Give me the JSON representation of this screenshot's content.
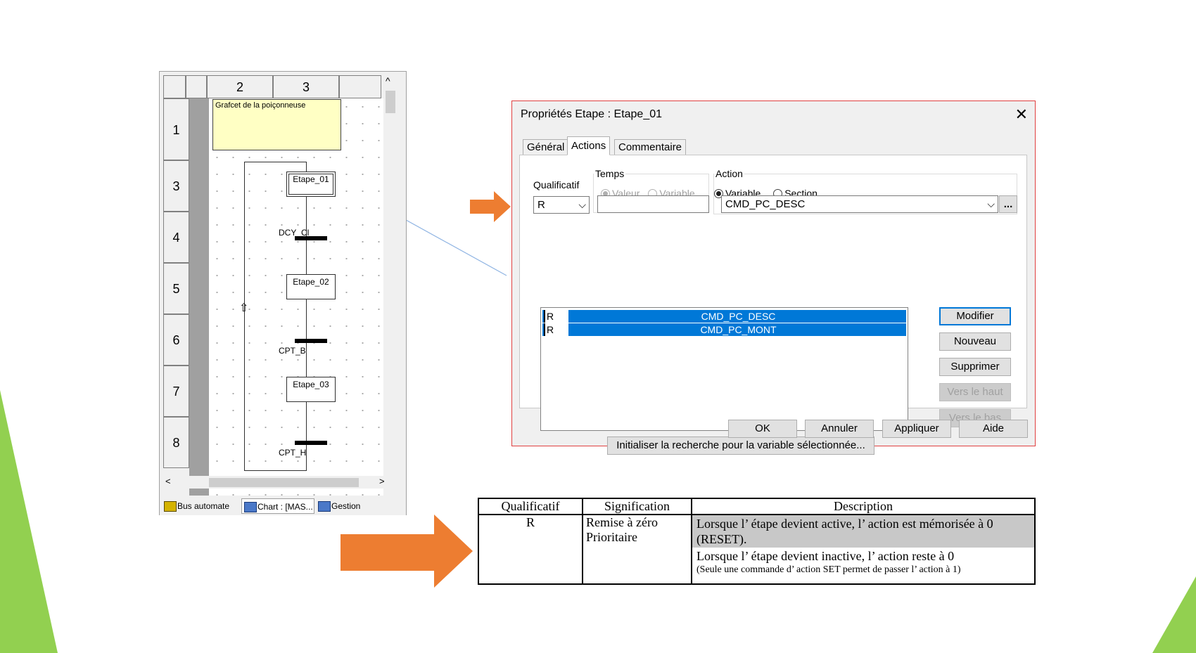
{
  "editor": {
    "col_headers": [
      "2",
      "3"
    ],
    "row_headers": [
      "1",
      "3",
      "4",
      "5",
      "6",
      "7",
      "8"
    ],
    "comment": "Grafcet de la poiçonneuse",
    "steps": [
      "Etape_01",
      "Etape_02",
      "Etape_03"
    ],
    "transitions": [
      "DCY_Cl",
      "CPT_B",
      "CPT_H"
    ],
    "scroll_up_glyph": "^",
    "scroll_left_glyph": "<",
    "scroll_right_glyph": ">",
    "bottom_tabs": [
      "Bus automate",
      "Chart : [MAS...",
      "Gestion"
    ]
  },
  "dialog": {
    "title": "Propriétés Etape : Etape_01",
    "close_glyph": "✕",
    "tabs": [
      "Général",
      "Actions",
      "Commentaire"
    ],
    "active_tab": "Actions",
    "qualificatif_label": "Qualificatif",
    "qualificatif_value": "R",
    "temps": {
      "legend": "Temps",
      "options": [
        "Valeur",
        "Variable"
      ],
      "value": ""
    },
    "action": {
      "legend": "Action",
      "options": [
        "Variable",
        "Section"
      ],
      "selected": "Variable",
      "value": "CMD_PC_DESC",
      "browse_label": "..."
    },
    "list_rows": [
      {
        "qualifier": "R",
        "variable": "CMD_PC_DESC"
      },
      {
        "qualifier": "R",
        "variable": "CMD_PC_MONT"
      }
    ],
    "side_buttons": {
      "modify": "Modifier",
      "new": "Nouveau",
      "delete": "Supprimer",
      "up": "Vers le haut",
      "down": "Vers le bas"
    },
    "search_button": "Initialiser la recherche pour la variable sélectionnée...",
    "footer_buttons": {
      "ok": "OK",
      "cancel": "Annuler",
      "apply": "Appliquer",
      "help": "Aide"
    }
  },
  "table": {
    "headers": [
      "Qualificatif",
      "Signification",
      "Description"
    ],
    "row": {
      "qualifier": "R",
      "meaning_line1": "Remise à zéro",
      "meaning_line2": "Prioritaire",
      "desc_highlight": "Lorsque l’ étape devient active, l’ action est mémorisée à 0 (RESET).",
      "desc_normal": "Lorsque l’ étape devient inactive, l’ action reste à 0",
      "desc_note": "(Seule une commande d’ action SET permet de passer l’ action à 1)"
    }
  },
  "colors": {
    "accent_green": "#92d050",
    "arrow_orange": "#ed7d31",
    "selection_blue": "#0078d7",
    "comment_yellow": "#ffffc4",
    "dialog_border": "#e04040"
  }
}
